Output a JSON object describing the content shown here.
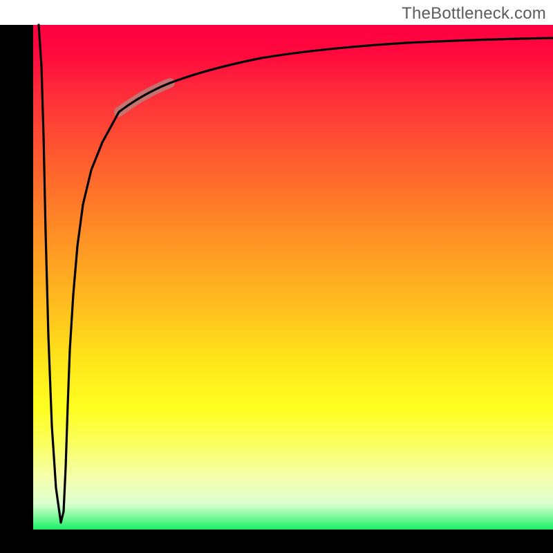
{
  "watermark": "TheBottleneck.com",
  "colors": {
    "gradient_top": "#ff0040",
    "gradient_mid": "#ffe31a",
    "gradient_bottom": "#19ef6a",
    "curve": "#000000",
    "curve_highlight": "#b97f7a",
    "axis": "#000000"
  },
  "chart_data": {
    "type": "line",
    "title": "",
    "xlabel": "",
    "ylabel": "",
    "xlim": [
      0,
      100
    ],
    "ylim": [
      0,
      100
    ],
    "series": [
      {
        "name": "bottleneck-curve-down",
        "x": [
          0.6,
          1.2,
          1.7,
          2.3,
          3.2,
          4.0,
          5.3
        ],
        "y": [
          100,
          80,
          55,
          35,
          18,
          8,
          0.5
        ]
      },
      {
        "name": "bottleneck-curve-up",
        "x": [
          5.3,
          6.0,
          6.8,
          8.0,
          10.0,
          13.0,
          17.0,
          22.0,
          28.0,
          36.0,
          46.0,
          58.0,
          72.0,
          86.0,
          100.0
        ],
        "y": [
          0.5,
          28,
          48,
          62,
          72,
          78,
          83,
          87,
          90,
          92.5,
          94.2,
          95.3,
          96.1,
          96.6,
          97.0
        ]
      }
    ],
    "annotations": [
      {
        "name": "highlight-segment",
        "x_range": [
          18,
          26
        ],
        "y_range": [
          84,
          89
        ],
        "desc": "thick pink highlight on curve"
      }
    ]
  }
}
